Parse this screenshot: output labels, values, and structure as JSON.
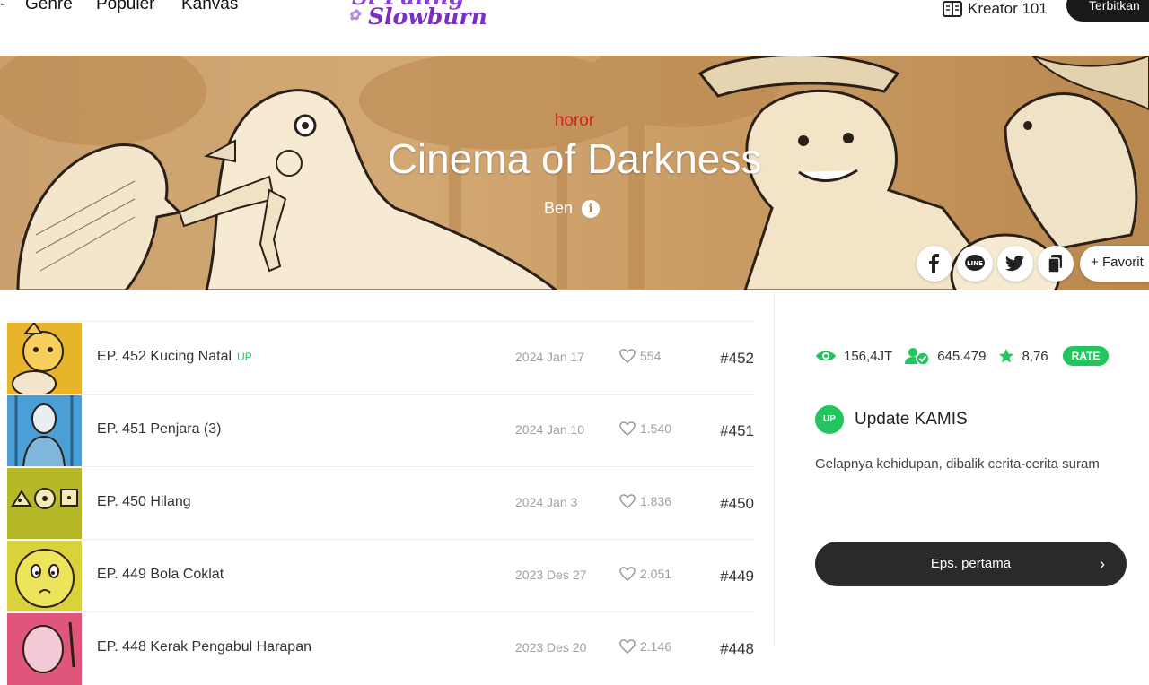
{
  "nav": {
    "items": [
      {
        "label": "Genre"
      },
      {
        "label": "Populer"
      },
      {
        "label": "Kanvas"
      }
    ],
    "logo_line1": "Si Paling",
    "logo_line2": "Slowburn",
    "creator_label": "Kreator 101",
    "publish_label": "Terbitkan"
  },
  "banner": {
    "genre": "horor",
    "title": "Cinema of Darkness",
    "author": "Ben",
    "info_glyph": "i",
    "favorite_label": "Favorit",
    "share_icons": [
      "facebook-icon",
      "line-icon",
      "twitter-icon",
      "copy-link-icon"
    ]
  },
  "episodes": [
    {
      "title": "EP. 452 Kucing Natal",
      "up": "UP",
      "date": "2024 Jan 17",
      "likes": "554",
      "number": "#452",
      "thumb_color": "#e8b52a"
    },
    {
      "title": "EP. 451 Penjara (3)",
      "up": "",
      "date": "2024 Jan 10",
      "likes": "1.540",
      "number": "#451",
      "thumb_color": "#4a9fd6"
    },
    {
      "title": "EP. 450 Hilang",
      "up": "",
      "date": "2024 Jan 3",
      "likes": "1.836",
      "number": "#450",
      "thumb_color": "#b6b82a"
    },
    {
      "title": "EP. 449 Bola Coklat",
      "up": "",
      "date": "2023 Des 27",
      "likes": "2.051",
      "number": "#449",
      "thumb_color": "#d9d23a"
    },
    {
      "title": "EP. 448 Kerak Pengabul Harapan",
      "up": "",
      "date": "2023 Des 20",
      "likes": "2.146",
      "number": "#448",
      "thumb_color": "#e0557a"
    }
  ],
  "side": {
    "views": "156,4JT",
    "subscribers": "645.479",
    "rating": "8,76",
    "rate_label": "RATE",
    "up_badge": "UP",
    "update_text": "Update KAMIS",
    "description": "Gelapnya kehidupan, dibalik cerita-cerita suram",
    "first_episode_label": "Eps. pertama"
  },
  "colors": {
    "accent_green": "#22c55e",
    "genre_red": "#d0241b",
    "banner_tan": "#caa06e",
    "dark_button": "#2a2a2a"
  }
}
